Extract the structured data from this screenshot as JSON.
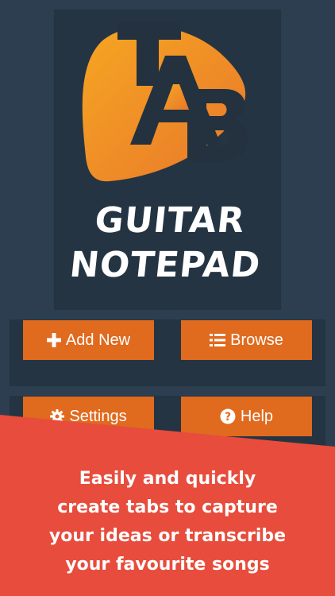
{
  "app": {
    "logo_text": "TAB",
    "title_line1": "GUITAR",
    "title_line2": "NOTEPAD"
  },
  "buttons": {
    "add_new": {
      "label": "Add New",
      "icon": "plus-icon"
    },
    "browse": {
      "label": "Browse",
      "icon": "list-icon"
    },
    "settings": {
      "label": "Settings",
      "icon": "gear-icon"
    },
    "help": {
      "label": "Help",
      "icon": "question-circle-icon"
    }
  },
  "promo": {
    "lines": [
      "Easily and quickly",
      "create tabs to capture",
      "your ideas or transcribe",
      "your favourite songs"
    ]
  },
  "colors": {
    "background": "#2c3e50",
    "panel": "#243443",
    "button": "#e06a1e",
    "banner": "#e74c3c",
    "logo_orange": "#f39c12"
  }
}
